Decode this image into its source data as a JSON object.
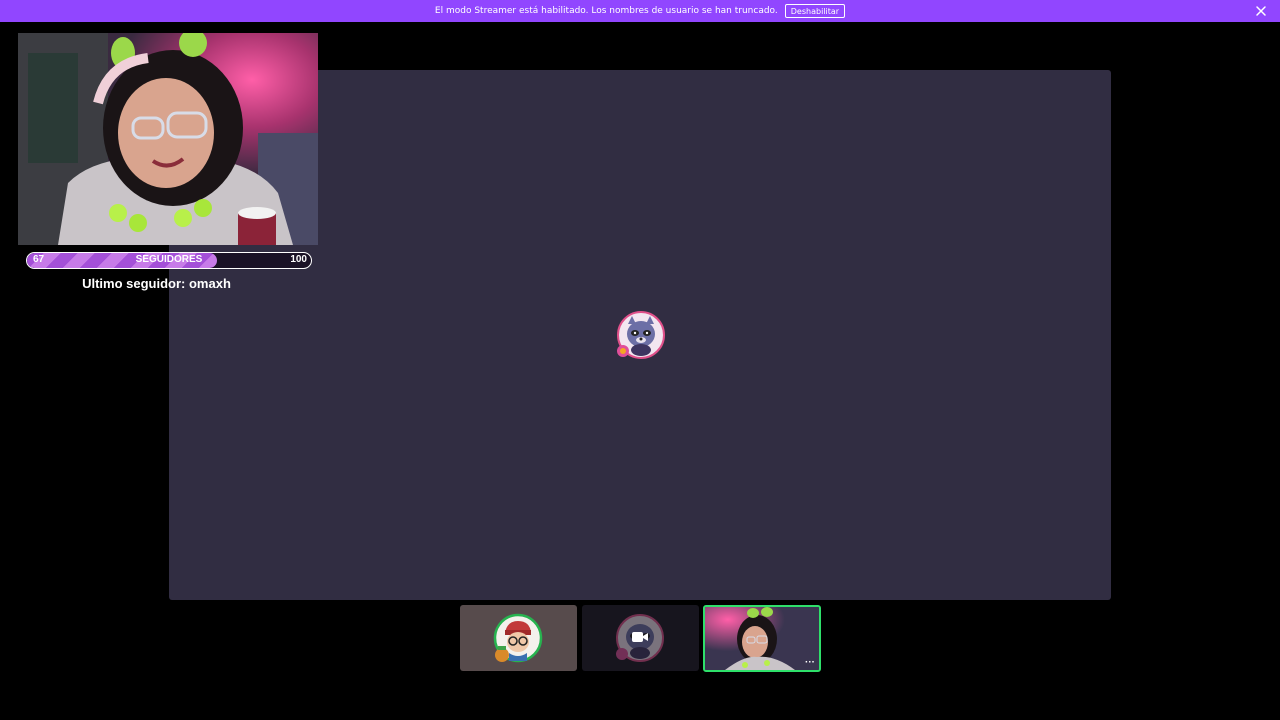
{
  "banner": {
    "message": "El modo Streamer está habilitado. Los nombres de usuario se han truncado.",
    "button_label": "Deshabilitar",
    "close_icon": "close-icon",
    "color": "#9146ff"
  },
  "overlay": {
    "progress": {
      "start_value": "67",
      "label": "SEGUIDORES",
      "end_value": "100",
      "fill_fraction": 0.67
    },
    "last_follower": "Ultimo seguidor: omaxh"
  },
  "stage": {
    "background": "#312d42",
    "avatar_icon": "raccoon-avatar-icon"
  },
  "participants": [
    {
      "avatar_icon": "boy-with-glasses-avatar-icon",
      "background": "#574b4c"
    },
    {
      "avatar_icon": "raccoon-avatar-icon",
      "background": "#17151e",
      "status_icon": "camera-icon"
    },
    {
      "avatar_icon": "webcam-thumbnail",
      "background": "#41395a",
      "border_color": "#2ee06a",
      "menu_label": "···"
    }
  ]
}
